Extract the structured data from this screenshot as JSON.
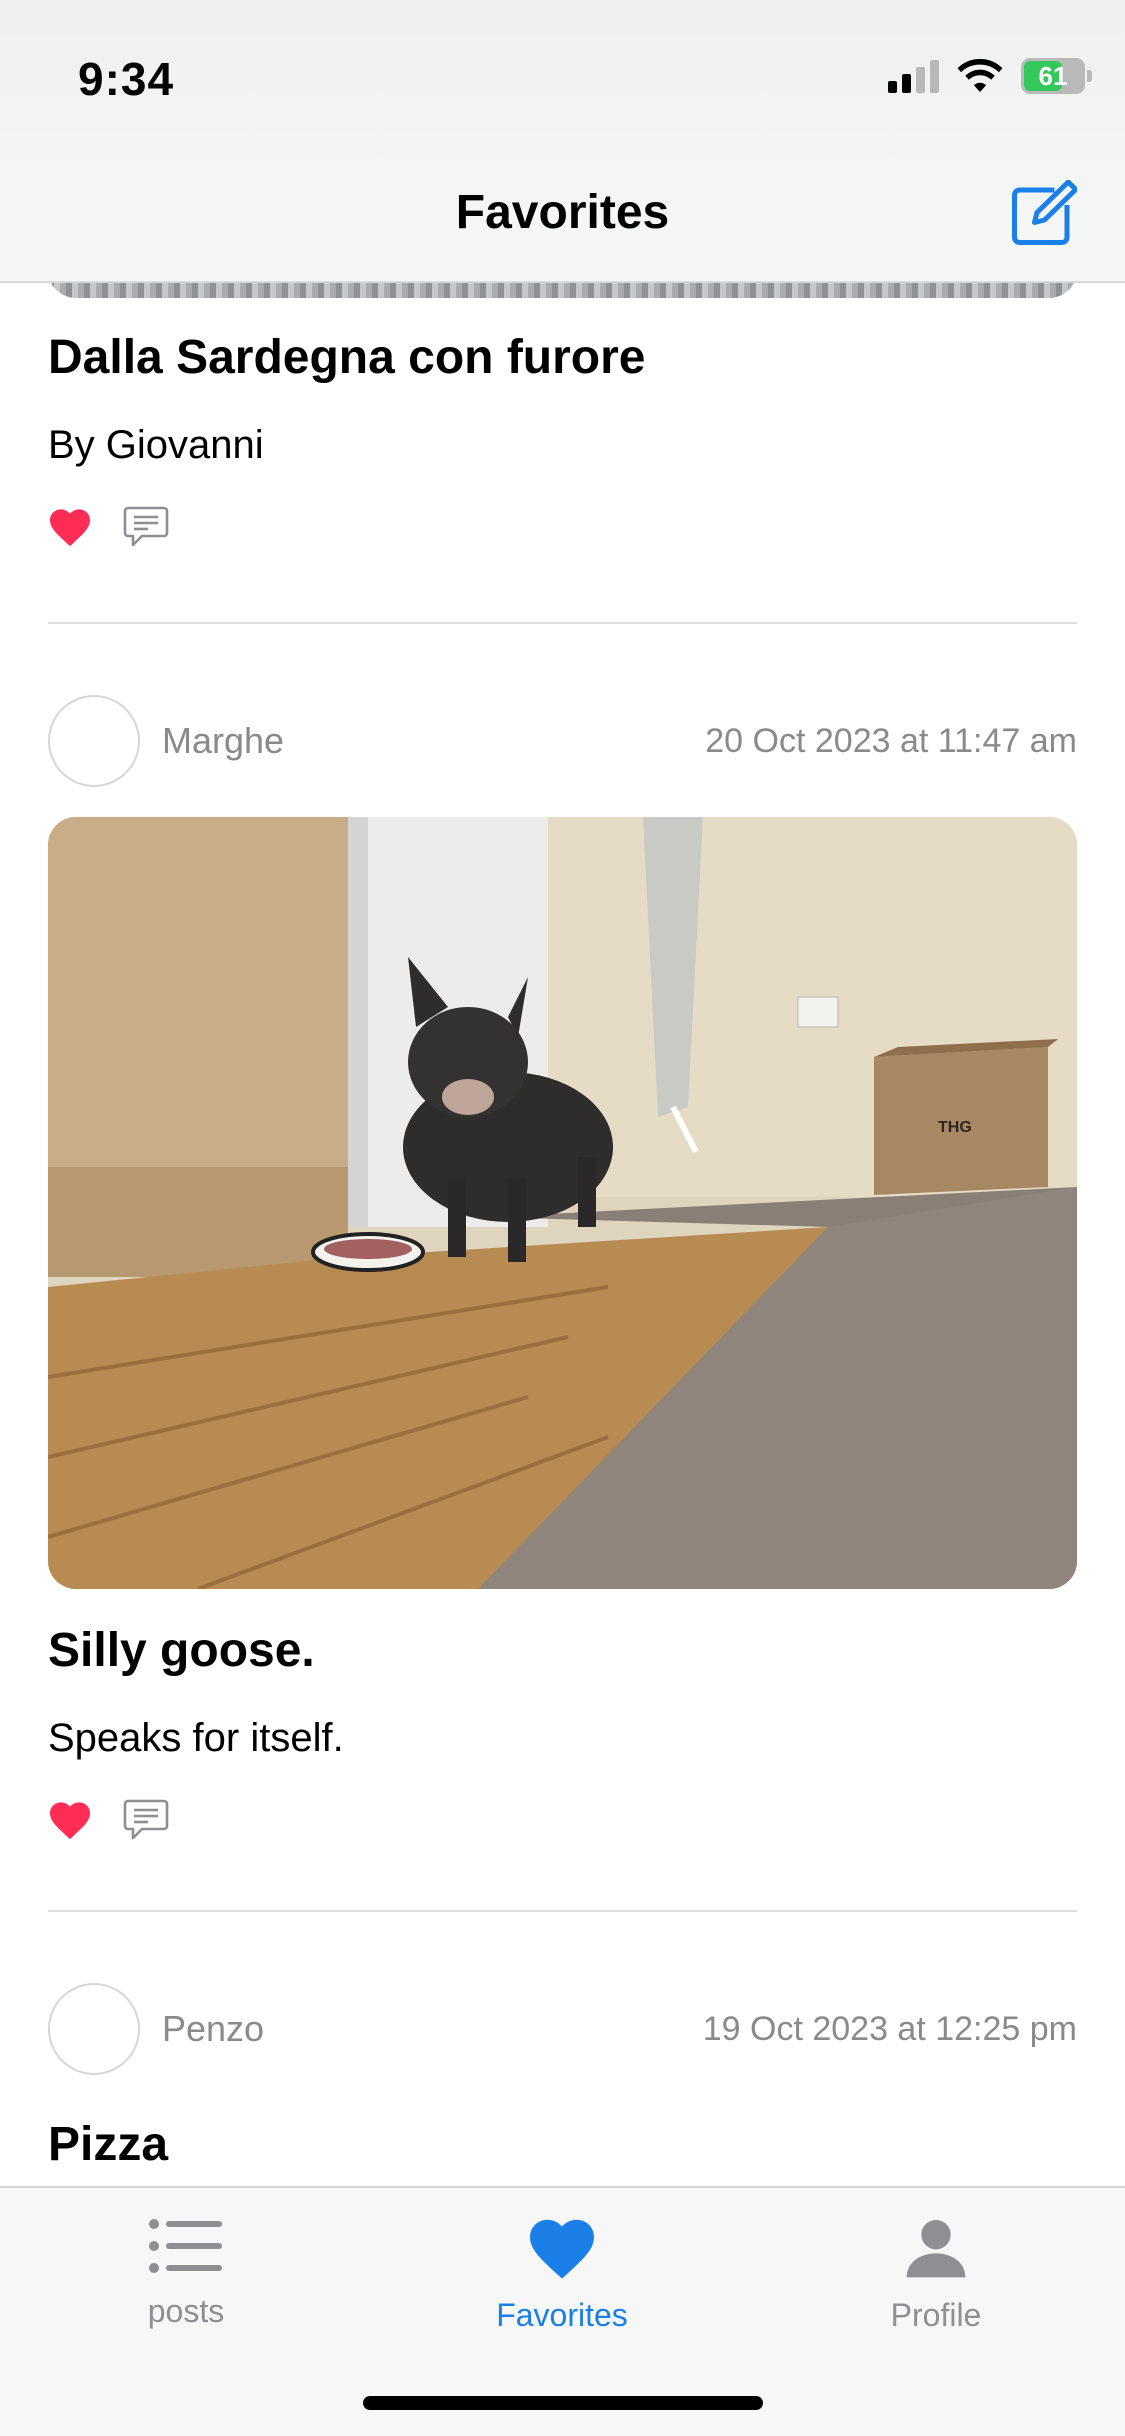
{
  "status_bar": {
    "time": "9:34",
    "battery": "61"
  },
  "nav": {
    "title": "Favorites"
  },
  "posts": [
    {
      "title": "Dalla Sardegna con furore",
      "body": "By Giovanni",
      "liked": true
    },
    {
      "author": "Marghe",
      "timestamp": "20 Oct 2023 at 11:47 am",
      "photo_label": "THG",
      "title": "Silly goose.",
      "body": "Speaks for itself.",
      "liked": true
    },
    {
      "author": "Penzo",
      "timestamp": "19 Oct 2023 at 12:25 pm",
      "title": "Pizza"
    }
  ],
  "tabbar": {
    "items": [
      {
        "label": "posts",
        "icon": "list-icon",
        "active": false
      },
      {
        "label": "Favorites",
        "icon": "heart-icon",
        "active": true
      },
      {
        "label": "Profile",
        "icon": "person-icon",
        "active": false
      }
    ]
  },
  "colors": {
    "accent": "#1a7fe6",
    "like": "#ff2d55",
    "secondary_text": "#8a8a8a"
  }
}
